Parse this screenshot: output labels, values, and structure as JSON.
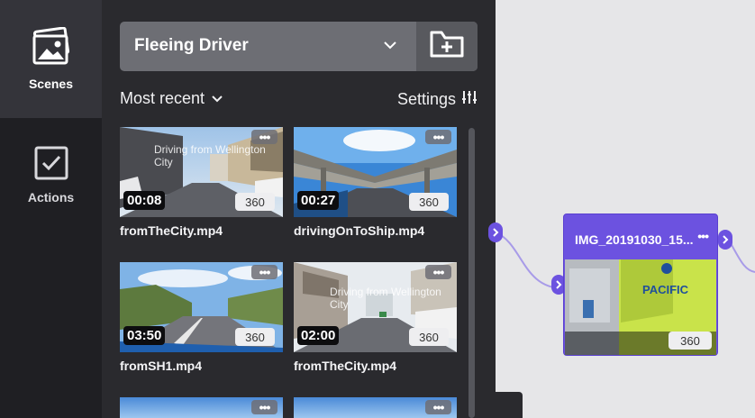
{
  "nav": {
    "items": [
      {
        "label": "Scenes",
        "icon": "photos-icon",
        "active": true
      },
      {
        "label": "Actions",
        "icon": "checkbox-icon",
        "active": false
      }
    ]
  },
  "project": {
    "name": "Fleeing Driver"
  },
  "toolbar": {
    "sort_label": "Most recent",
    "settings_label": "Settings"
  },
  "media": [
    {
      "file": "fromTheCity.mp4",
      "duration": "00:08",
      "badge": "360",
      "overlay_text": "Driving from Wellington City"
    },
    {
      "file": "drivingOnToShip.mp4",
      "duration": "00:27",
      "badge": "360",
      "overlay_text": ""
    },
    {
      "file": "fromSH1.mp4",
      "duration": "03:50",
      "badge": "360",
      "overlay_text": ""
    },
    {
      "file": "fromTheCity.mp4",
      "duration": "02:00",
      "badge": "360",
      "overlay_text": "Driving from Wellington City"
    }
  ],
  "node": {
    "title": "IMG_20191030_15...",
    "badge": "360",
    "image_text": "PACIFIC"
  },
  "colors": {
    "accent": "#6c52e0",
    "panel": "#2a2a2e",
    "nav": "#1f1f23",
    "canvas": "#e6e6e8"
  }
}
